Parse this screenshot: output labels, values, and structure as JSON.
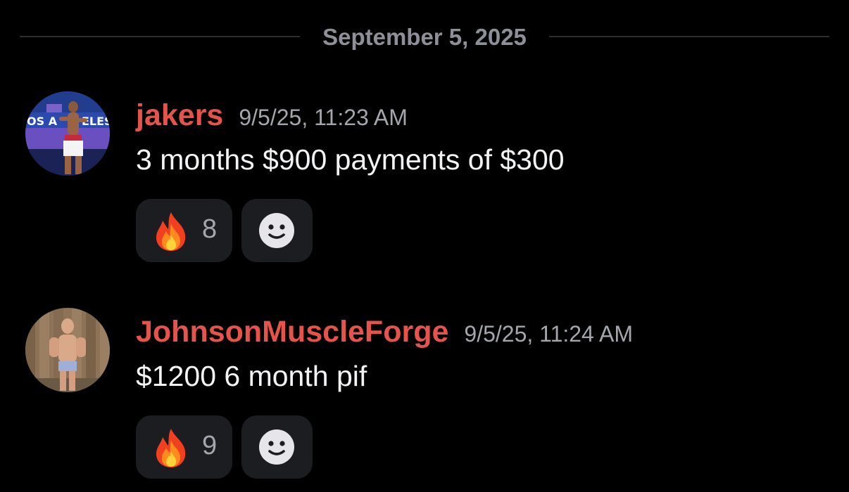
{
  "date_divider": {
    "label": "September 5, 2025"
  },
  "messages": [
    {
      "username": "jakers",
      "timestamp": "9/5/25, 11:23 AM",
      "content": "3 months $900 payments of $300",
      "reactions": [
        {
          "emoji": "fire",
          "count": "8"
        }
      ],
      "add_reaction_icon": "smiley-add-reaction-icon"
    },
    {
      "username": "JohnsonMuscleForge",
      "timestamp": "9/5/25, 11:24 AM",
      "content": "$1200 6 month pif",
      "reactions": [
        {
          "emoji": "fire",
          "count": "9"
        }
      ],
      "add_reaction_icon": "smiley-add-reaction-icon"
    }
  ],
  "colors": {
    "background": "#000000",
    "username": "#e5534b",
    "timestamp": "#a3a6ad",
    "reaction_bg": "#1c1d21",
    "divider": "#2b2d31"
  }
}
